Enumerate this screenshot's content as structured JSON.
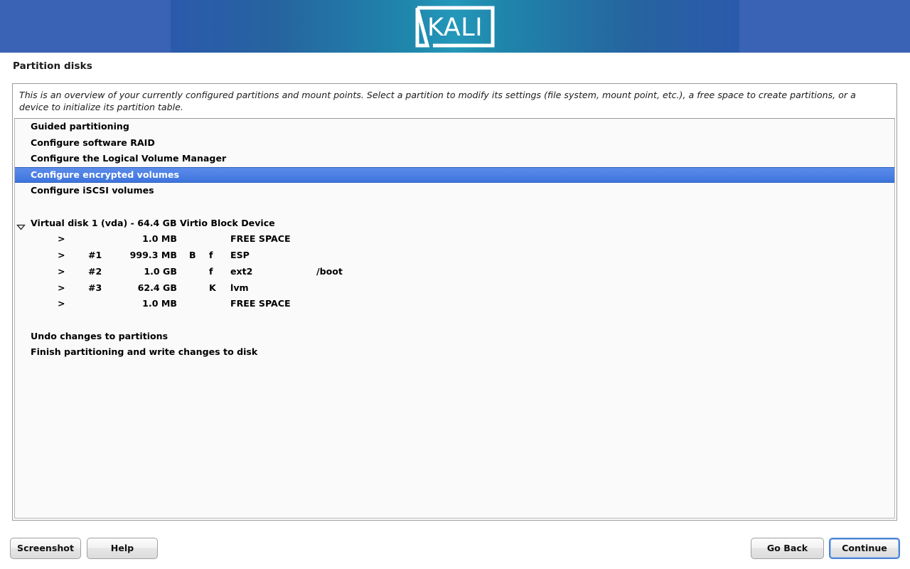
{
  "banner": {
    "logo_text": "KALI",
    "colors": {
      "flat_blue": "#3a63b5",
      "gradient_edge": "#2b5aad",
      "gradient_center": "#2498ba"
    }
  },
  "page": {
    "title": "Partition disks",
    "description": "This is an overview of your currently configured partitions and mount points. Select a partition to modify its settings (file system, mount point, etc.), a free space to create partitions, or a device to initialize its partition table."
  },
  "list": {
    "menu_items": [
      {
        "label": "Guided partitioning",
        "selected": false
      },
      {
        "label": "Configure software RAID",
        "selected": false
      },
      {
        "label": "Configure the Logical Volume Manager",
        "selected": false
      },
      {
        "label": "Configure encrypted volumes",
        "selected": true
      },
      {
        "label": "Configure iSCSI volumes",
        "selected": false
      }
    ],
    "disk": {
      "expander": "expanded",
      "label": "Virtual disk 1 (vda) - 64.4 GB Virtio Block Device",
      "partitions": [
        {
          "arrow": ">",
          "number": "",
          "size": "1.0 MB",
          "flag1": "",
          "flag2": "",
          "type": "FREE SPACE",
          "mount": ""
        },
        {
          "arrow": ">",
          "number": "#1",
          "size": "999.3 MB",
          "flag1": "B",
          "flag2": "f",
          "type": "ESP",
          "mount": ""
        },
        {
          "arrow": ">",
          "number": "#2",
          "size": "1.0 GB",
          "flag1": "",
          "flag2": "f",
          "type": "ext2",
          "mount": "/boot"
        },
        {
          "arrow": ">",
          "number": "#3",
          "size": "62.4 GB",
          "flag1": "",
          "flag2": "K",
          "type": "lvm",
          "mount": ""
        },
        {
          "arrow": ">",
          "number": "",
          "size": "1.0 MB",
          "flag1": "",
          "flag2": "",
          "type": "FREE SPACE",
          "mount": ""
        }
      ]
    },
    "actions": [
      {
        "label": "Undo changes to partitions"
      },
      {
        "label": "Finish partitioning and write changes to disk"
      }
    ]
  },
  "footer": {
    "screenshot_label": "Screenshot",
    "help_label": "Help",
    "goback_label": "Go Back",
    "continue_label": "Continue",
    "focused_button": "Continue",
    "focus_color": "#4a84d8"
  }
}
